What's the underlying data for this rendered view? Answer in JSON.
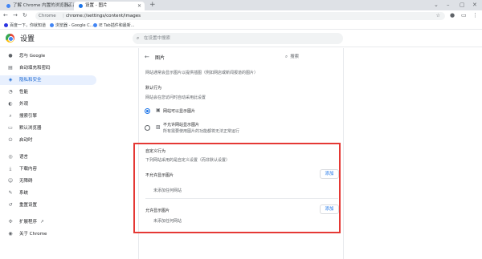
{
  "tabs": [
    {
      "title": "了解 Chrome 内置的浏览器工具"
    },
    {
      "title": "设置 - 图片"
    }
  ],
  "toolbar": {
    "site_label": "Chrome",
    "url": "chrome://settings/content/images"
  },
  "bookmarks": [
    {
      "label": "百度一下，你就知道",
      "color": "#2932e1"
    },
    {
      "label": "浏览器 - Google C...",
      "color": "#4285f4"
    },
    {
      "label": "IE Tab插件和最新...",
      "color": "#4285f4"
    }
  ],
  "settings": {
    "title": "设置",
    "search_placeholder": "在设置中搜索"
  },
  "sidebar": {
    "items": [
      {
        "label": "您与 Google",
        "icon": "person-icon"
      },
      {
        "label": "自动填充和密码",
        "icon": "autofill-icon"
      },
      {
        "label": "隐私和安全",
        "icon": "shield-icon",
        "active": true
      },
      {
        "label": "性能",
        "icon": "speed-icon"
      },
      {
        "label": "外观",
        "icon": "palette-icon"
      },
      {
        "label": "搜索引擎",
        "icon": "search-icon"
      },
      {
        "label": "默认浏览器",
        "icon": "browser-icon"
      },
      {
        "label": "启动时",
        "icon": "power-icon"
      },
      {
        "label": "语言",
        "icon": "globe-icon"
      },
      {
        "label": "下载内容",
        "icon": "download-icon"
      },
      {
        "label": "无障碍",
        "icon": "accessibility-icon"
      },
      {
        "label": "系统",
        "icon": "wrench-icon"
      },
      {
        "label": "重置设置",
        "icon": "reset-icon"
      },
      {
        "label": "扩展程序",
        "icon": "puzzle-icon"
      },
      {
        "label": "关于 Chrome",
        "icon": "chrome-icon"
      }
    ]
  },
  "content": {
    "page_title": "图片",
    "search_label": "搜索",
    "description": "网站通常会显示图片以提供插图（例如网店或新闻报道的图片）",
    "default_heading": "默认行为",
    "default_sub": "网站会在您访问时自动采用此设置",
    "option_allow": "网站可以显示图片",
    "option_block": "不允许网站显示图片",
    "option_block_sub": "所有需要使用图片的功能都将无法正常运行",
    "custom_heading": "自定义行为",
    "custom_sub": "下列网站采用的是自定义设置（而非默认设置）",
    "block_list_label": "不允许显示图片",
    "block_empty": "未添加任何网站",
    "allow_list_label": "允许显示图片",
    "allow_empty": "未添加任何网站",
    "add_label": "添加"
  }
}
